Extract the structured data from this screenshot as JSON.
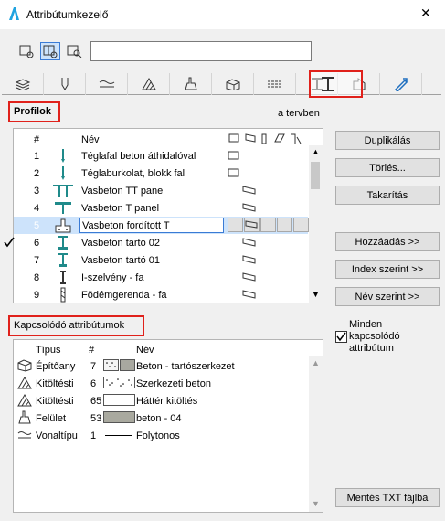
{
  "window": {
    "title": "Attribútumkezelő"
  },
  "search": {
    "value": ""
  },
  "toolbar": {
    "view_modes": [
      "list-view-icon",
      "grid-view-icon",
      "search-view-icon"
    ],
    "selected": 1
  },
  "tabs": {
    "icons": [
      "layers-icon",
      "pen-icon",
      "line-type-icon",
      "fill-icon",
      "surface-icon",
      "building-material-icon",
      "zone-icon",
      "profile-icon",
      "composite-icon",
      "renovation-icon"
    ],
    "selected": 7
  },
  "profiles": {
    "section_title": "Profilok",
    "in_plan_label": "a tervben",
    "columns": {
      "num": "#",
      "name": "Név"
    },
    "rows": [
      {
        "num": "1",
        "name": "Téglafal beton áthidalóval",
        "checked": false
      },
      {
        "num": "2",
        "name": "Téglaburkolat, blokk fal",
        "checked": false
      },
      {
        "num": "3",
        "name": "Vasbeton TT panel",
        "checked": false
      },
      {
        "num": "4",
        "name": "Vasbeton T panel",
        "checked": false
      },
      {
        "num": "5",
        "name": "Vasbeton fordított T",
        "checked": false
      },
      {
        "num": "6",
        "name": "Vasbeton tartó 02",
        "checked": true
      },
      {
        "num": "7",
        "name": "Vasbeton tartó 01",
        "checked": false
      },
      {
        "num": "8",
        "name": "I-szelvény - fa",
        "checked": false
      },
      {
        "num": "9",
        "name": "Födémgerenda - fa",
        "checked": false
      }
    ],
    "selected_row": 4
  },
  "buttons": {
    "duplicate": "Duplikálás",
    "delete": "Törlés...",
    "cleanup": "Takarítás",
    "add": "Hozzáadás >>",
    "by_index": "Index szerint >>",
    "by_name": "Név szerint >>",
    "save_txt": "Mentés TXT fájlba"
  },
  "related": {
    "section_title": "Kapcsolódó attribútumok",
    "columns": {
      "type": "Típus",
      "num": "#",
      "name": "Név"
    },
    "rows": [
      {
        "icon": "building-material-icon",
        "type": "Építőany",
        "num": "7",
        "name": "Beton - tartószerkezet",
        "swatch": [
          "dots",
          "#a8a8a0"
        ]
      },
      {
        "icon": "fill-icon",
        "type": "Kitöltésti",
        "num": "6",
        "name": "Szerkezeti beton",
        "swatch": [
          "dots-wide"
        ]
      },
      {
        "icon": "fill-icon",
        "type": "Kitöltésti",
        "num": "65",
        "name": "Háttér kitöltés",
        "swatch": [
          "blank"
        ]
      },
      {
        "icon": "surface-icon",
        "type": "Felület",
        "num": "53",
        "name": "beton - 04",
        "swatch": [
          "#a9a99f"
        ]
      },
      {
        "icon": "line-type-icon",
        "type": "Vonaltípu",
        "num": "1",
        "name": "Folytonos",
        "swatch": [
          "line"
        ]
      }
    ]
  },
  "all_related": {
    "label": "Minden kapcsolódó attribútum",
    "checked": true
  },
  "colors": {
    "accent": "#3a7bd5",
    "highlight": "#e0211b",
    "profile_teal": "#1f8a8a"
  }
}
